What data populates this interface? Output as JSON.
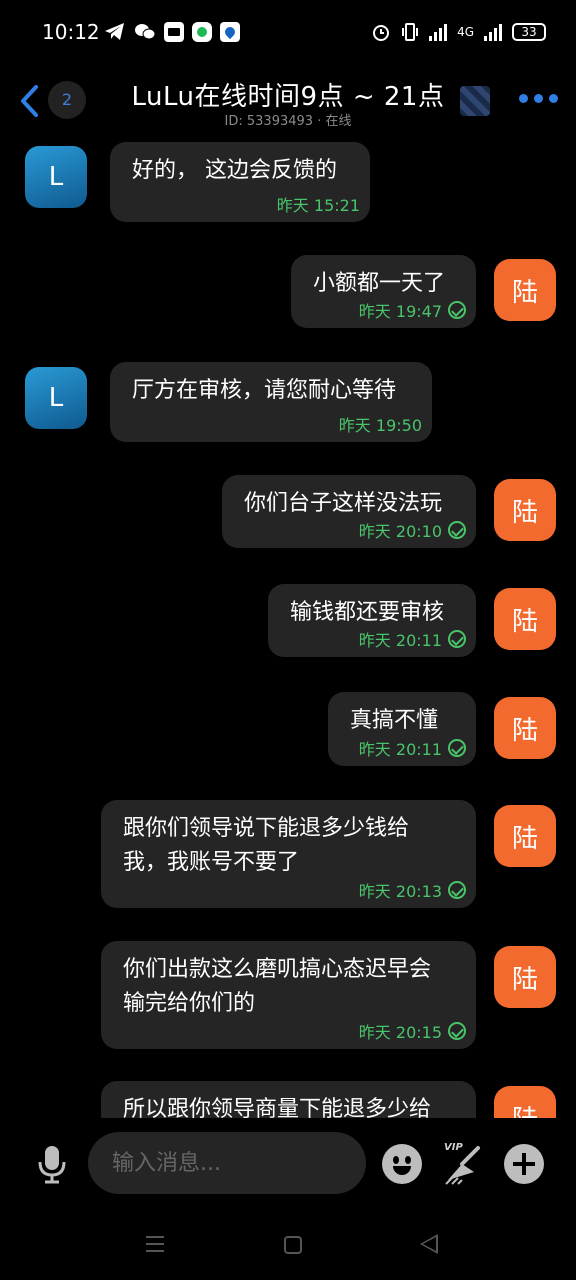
{
  "status_bar": {
    "time": "10:12",
    "left_icons": [
      "telegram-icon",
      "wechat-icon",
      "mail-icon",
      "spotify-icon",
      "drop-icon"
    ],
    "network": "4G",
    "battery": "33"
  },
  "header": {
    "unread_count": "2",
    "title": "LuLu在线时间9点 ~ 21点",
    "subtitle": "ID: 53393493 · 在线",
    "accent_color": "#2f7fe4"
  },
  "messages": [
    {
      "side": "in",
      "avatar": "L",
      "text": "好的， 这边会反馈的",
      "time": "昨天 15:21",
      "read": false
    },
    {
      "side": "out",
      "avatar": "陆",
      "text": "小额都一天了",
      "time": "昨天 19:47",
      "read": true
    },
    {
      "side": "in",
      "avatar": "L",
      "text": "厅方在审核，请您耐心等待",
      "time": "昨天 19:50",
      "read": false
    },
    {
      "side": "out",
      "avatar": "陆",
      "text": "你们台子这样没法玩",
      "time": "昨天 20:10",
      "read": true
    },
    {
      "side": "out",
      "avatar": "陆",
      "text": "输钱都还要审核",
      "time": "昨天 20:11",
      "read": true
    },
    {
      "side": "out",
      "avatar": "陆",
      "text": "真搞不懂",
      "time": "昨天 20:11",
      "read": true
    },
    {
      "side": "out",
      "avatar": "陆",
      "text": "跟你们领导说下能退多少钱给\n我，我账号不要了",
      "time": "昨天 20:13",
      "read": true
    },
    {
      "side": "out",
      "avatar": "陆",
      "text": "你们出款这么磨叽搞心态迟早会\n输完给你们的",
      "time": "昨天 20:15",
      "read": true
    },
    {
      "side": "out",
      "avatar": "陆",
      "text": "所以跟你领导商量下能退多少给",
      "time": "",
      "read": false
    }
  ],
  "input": {
    "placeholder": "输入消息...",
    "vip_label": "VIP"
  },
  "colors": {
    "bubble_bg": "#252525",
    "time_green": "#49c46a",
    "my_avatar": "#f26a2e"
  }
}
